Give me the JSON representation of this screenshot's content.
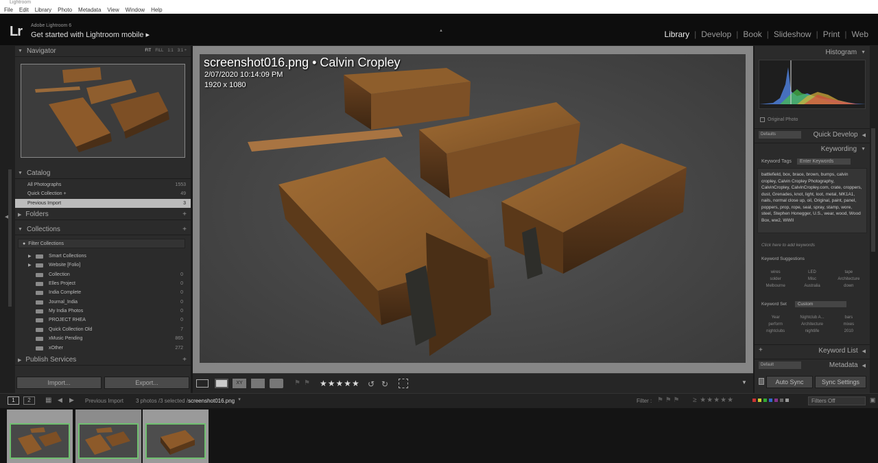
{
  "window_title": "Lightroom",
  "menu": [
    "File",
    "Edit",
    "Library",
    "Photo",
    "Metadata",
    "View",
    "Window",
    "Help"
  ],
  "identity": {
    "logo": "Lr",
    "app_name": "Adobe Lightroom 6",
    "mobile": "Get started with Lightroom mobile ▸"
  },
  "modules": [
    "Library",
    "Develop",
    "Book",
    "Slideshow",
    "Print",
    "Web"
  ],
  "active_module": "Library",
  "navigator": {
    "title": "Navigator",
    "options": [
      "FIT",
      "FILL",
      "1:1",
      "3:1 ÷"
    ]
  },
  "catalog": {
    "title": "Catalog",
    "items": [
      {
        "label": "All Photographs",
        "count": "1553"
      },
      {
        "label": "Quick Collection +",
        "count": "49"
      },
      {
        "label": "Previous Import",
        "count": "3"
      }
    ]
  },
  "folders": {
    "title": "Folders"
  },
  "collections": {
    "title": "Collections",
    "filter": "Filter Collections",
    "items": [
      {
        "label": "Smart Collections",
        "count": "",
        "expander": "▶"
      },
      {
        "label": "Website [Folio]",
        "count": "",
        "expander": "▶"
      },
      {
        "label": "Collection",
        "count": "0",
        "expander": ""
      },
      {
        "label": "Elles Project",
        "count": "0",
        "expander": ""
      },
      {
        "label": "India Complete",
        "count": "0",
        "expander": ""
      },
      {
        "label": "Journal_India",
        "count": "0",
        "expander": ""
      },
      {
        "label": "My India Photos",
        "count": "0",
        "expander": ""
      },
      {
        "label": "PROJECT RHEA",
        "count": "0",
        "expander": ""
      },
      {
        "label": "Quick Collection Old",
        "count": "7",
        "expander": ""
      },
      {
        "label": "xMusic Pending",
        "count": "865",
        "expander": ""
      },
      {
        "label": "xOther",
        "count": "272",
        "expander": ""
      }
    ]
  },
  "publish": {
    "title": "Publish Services"
  },
  "buttons": {
    "import": "Import...",
    "export": "Export..."
  },
  "photo_info": {
    "filename_line": "screenshot016.png  •  Calvin Cropley",
    "date": "2/07/2020 10:14:09 PM",
    "dimensions": "1920 x 1080"
  },
  "right": {
    "histogram": "Histogram",
    "original_photo": "Original Photo",
    "quick_develop": "Quick Develop",
    "defaults": "Defaults",
    "keywording": "Keywording",
    "keyword_tags_label": "Keyword Tags",
    "keyword_tags_value": "Enter Keywords",
    "keywords_text": "battlefield, box, brace, brown, bumps, calvin cropley, Calvin Cropley Photography, CalvinCropley, CalvinCropley.com, crate, croppers, dust, Grenades, knot, light, loot, metal, MK1A1, nails, normal close up, oil, Original, paint, panel, poppers, prop, rope, seal, spray, stamp, wore, steel, Stephen Honegger, U.S., wear, wood, Wood Box, ww2, WWII",
    "add_keywords": "Click here to add keywords",
    "suggestions_title": "Keyword Suggestions",
    "suggestions": [
      "wires",
      "LED",
      "tape",
      "solder",
      "Misc",
      "Architecture",
      "Melbourne",
      "Australia",
      "down"
    ],
    "keyword_set_label": "Keyword Set",
    "keyword_set_value": "Custom",
    "keyword_set": [
      "Year",
      "Nightclub A...",
      "bars",
      "perform",
      "Architecture",
      "mixes",
      "nightclubs",
      "nightlife",
      "2010"
    ],
    "keyword_list": "Keyword List",
    "metadata": "Metadata",
    "metadata_preset": "Default",
    "auto_sync": "Auto Sync",
    "sync_settings": "Sync Settings"
  },
  "toolbar": {
    "stars": "★★★★★"
  },
  "filmstrip_bar": {
    "screen1": "1",
    "screen2": "2",
    "source": "Previous Import",
    "selection": "3 photos /3 selected /",
    "current": "screenshot016.png",
    "filter_label": "Filter :",
    "filters_off": "Filters Off"
  },
  "colors": {
    "accent_thumb_border": "#6fbf6f",
    "selected_row": "#bcbcbc"
  }
}
